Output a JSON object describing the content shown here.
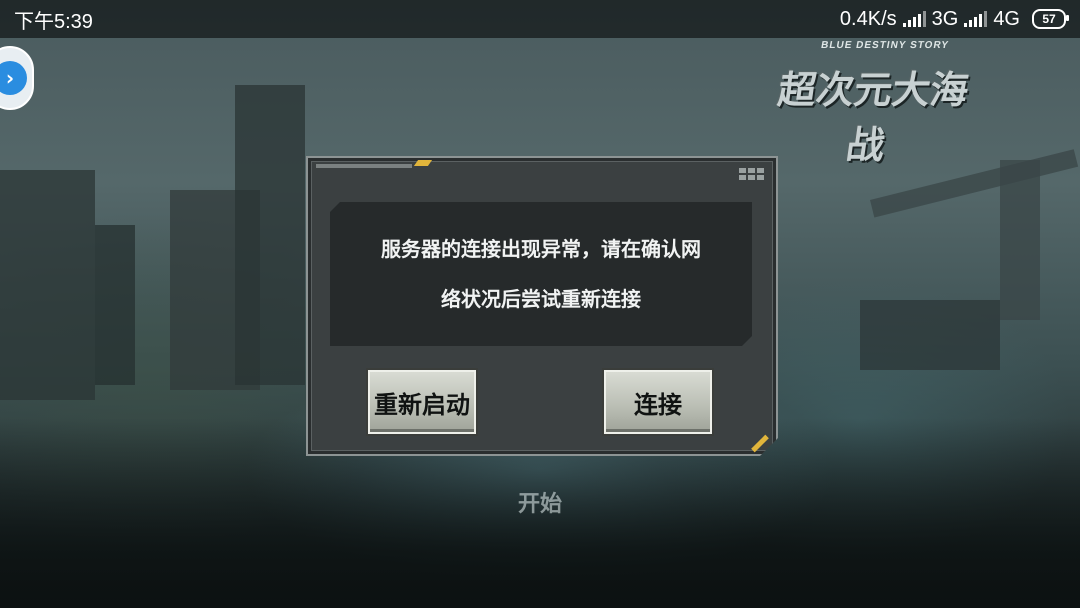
{
  "status_bar": {
    "time": "下午5:39",
    "network_speed": "0.4K/s",
    "network_3g": "3G",
    "network_4g": "4G",
    "battery": "57"
  },
  "game": {
    "logo_subtitle": "BLUE DESTINY STORY",
    "logo_title": "超次元大海战",
    "start_label": "开始"
  },
  "dialog": {
    "message_line1": "服务器的连接出现异常，请在确认网",
    "message_line2": "络状况后尝试重新连接",
    "restart_label": "重新启动",
    "connect_label": "连接"
  },
  "colors": {
    "accent": "#e1b53b",
    "float_button": "#2a8de0"
  }
}
